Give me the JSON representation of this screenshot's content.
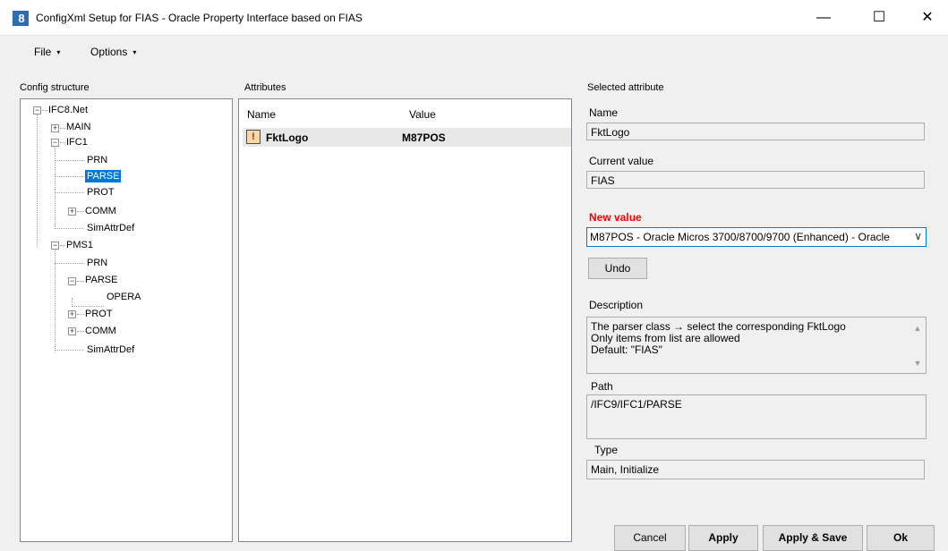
{
  "window": {
    "icon_text": "8",
    "title": "ConfigXml Setup for FIAS - Oracle Property Interface based on FIAS",
    "minimize": "—",
    "maximize": "☐",
    "close": "✕"
  },
  "menu": {
    "items": [
      {
        "label": "File"
      },
      {
        "label": "Options"
      }
    ],
    "caret": "▾"
  },
  "config_structure": {
    "label": "Config structure",
    "tree": [
      {
        "label": "IFC8.Net",
        "expander": "−"
      },
      {
        "label": "MAIN",
        "expander": "+"
      },
      {
        "label": "IFC1",
        "expander": "−"
      },
      {
        "label": "PRN"
      },
      {
        "label": "PARSE",
        "selected": true
      },
      {
        "label": "PROT"
      },
      {
        "label": "COMM",
        "expander": "+"
      },
      {
        "label": "SimAttrDef"
      },
      {
        "label": "PMS1",
        "expander": "−"
      },
      {
        "label": "PRN"
      },
      {
        "label": "PARSE",
        "expander": "−"
      },
      {
        "label": "OPERA"
      },
      {
        "label": "PROT",
        "expander": "+"
      },
      {
        "label": "COMM",
        "expander": "+"
      },
      {
        "label": "SimAttrDef"
      }
    ]
  },
  "attributes": {
    "label": "Attributes",
    "col_name": "Name",
    "col_value": "Value",
    "rows": [
      {
        "name": "FktLogo",
        "value": "M87POS",
        "icon": "!"
      }
    ]
  },
  "selected_attribute": {
    "label": "Selected attribute",
    "name_label": "Name",
    "name_value": "FktLogo",
    "current_label": "Current value",
    "current_value": "FIAS",
    "new_label": "New value",
    "new_value": "M87POS - Oracle Micros 3700/8700/9700 (Enhanced) - Oracle",
    "combo_arrow": "∨",
    "undo": "Undo",
    "description_label": "Description",
    "description_lines": [
      "The parser class → select the corresponding FktLogo",
      "Only items from list are allowed",
      "Default: \"FIAS\""
    ],
    "path_label": "Path",
    "path_value": "/IFC9/IFC1/PARSE",
    "type_label": "Type",
    "type_value": "Main, Initialize"
  },
  "buttons": {
    "cancel": "Cancel",
    "apply": "Apply",
    "apply_save": "Apply & Save",
    "ok": "Ok"
  },
  "colors": {
    "accent": "#0078d7",
    "new_value": "#ff0000"
  }
}
